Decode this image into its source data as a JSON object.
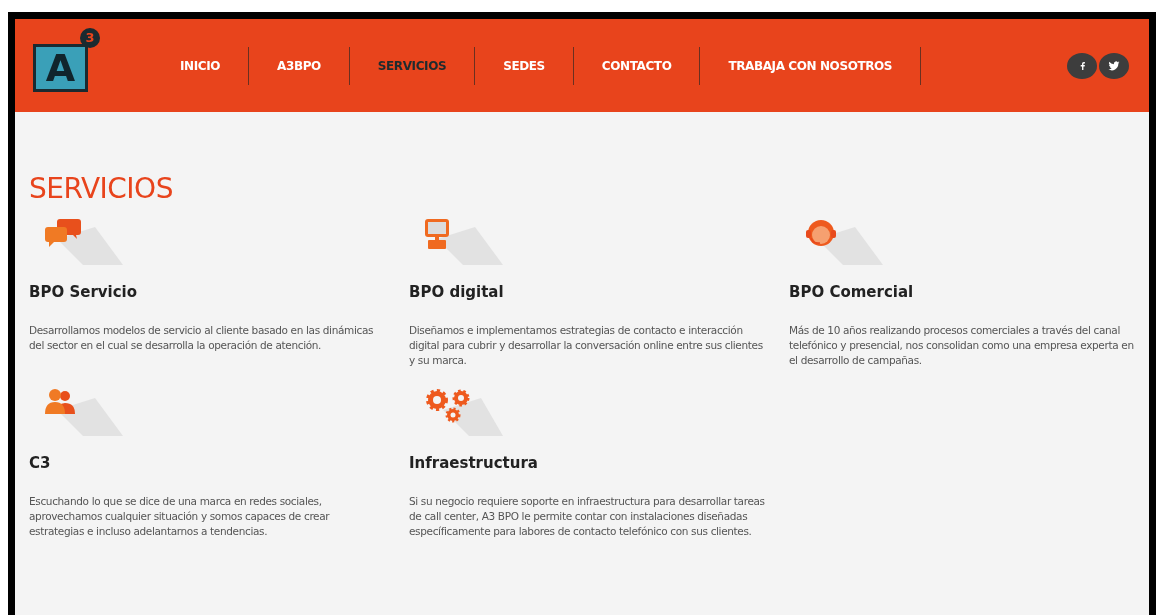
{
  "logo": {
    "letter": "A",
    "superscript": "3"
  },
  "nav": [
    {
      "label": "INICIO",
      "selected": false
    },
    {
      "label": "A3BPO",
      "selected": false
    },
    {
      "label": "SERVICIOS",
      "selected": true
    },
    {
      "label": "SEDES",
      "selected": false
    },
    {
      "label": "CONTACTO",
      "selected": false
    },
    {
      "label": "TRABAJA CON NOSOTROS",
      "selected": false
    }
  ],
  "social": [
    {
      "kind": "facebook"
    },
    {
      "kind": "twitter"
    }
  ],
  "heading": "SERVICIOS",
  "services": [
    {
      "kind": "chat",
      "title": "BPO Servicio",
      "text": "Desarrollamos modelos de servicio al cliente basado en las dinámicas del sector en el cual se desarrolla la operación de atención."
    },
    {
      "kind": "computer",
      "title": "BPO digital",
      "text": "Diseñamos e implementamos estrategias de contacto e interacción digital para cubrir y desarrollar la conversación online entre sus clientes y su marca."
    },
    {
      "kind": "headset",
      "title": "BPO Comercial",
      "text": "Más de 10 años realizando procesos comerciales a través del canal telefónico y presencial, nos consolidan como una empresa experta en el desarrollo de campañas."
    },
    {
      "kind": "people",
      "title": "C3",
      "text": "Escuchando lo que se dice de una marca en redes sociales, aprovechamos cualquier situación y somos capaces de crear estrategias e incluso adelantarnos a tendencias."
    },
    {
      "kind": "gears",
      "title": "Infraestructura",
      "text": "Si su negocio requiere soporte en infraestructura para desarrollar tareas de call center, A3 BPO le permite contar con instalaciones diseñadas específicamente para labores de contacto telefónico con sus clientes."
    }
  ]
}
